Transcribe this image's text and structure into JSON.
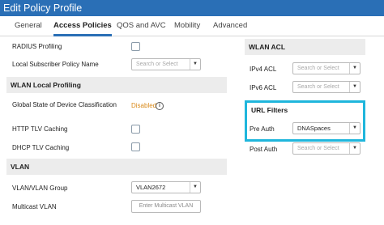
{
  "window": {
    "title": "Edit Policy Profile"
  },
  "tabs": [
    {
      "label": "General"
    },
    {
      "label": "Access Policies"
    },
    {
      "label": "QOS and AVC"
    },
    {
      "label": "Mobility"
    },
    {
      "label": "Advanced"
    }
  ],
  "left": {
    "radius_profiling": {
      "label": "RADIUS Profiling"
    },
    "local_subscriber": {
      "label": "Local Subscriber Policy Name",
      "placeholder": "Search or Select"
    },
    "wlan_local_profiling": {
      "title": "WLAN Local Profiling"
    },
    "global_state": {
      "label": "Global State of Device Classification",
      "value": "Disabled"
    },
    "http_tlv": {
      "label": "HTTP TLV Caching"
    },
    "dhcp_tlv": {
      "label": "DHCP TLV Caching"
    },
    "vlan": {
      "title": "VLAN"
    },
    "vlan_group": {
      "label": "VLAN/VLAN Group",
      "value": "VLAN2672"
    },
    "multicast_vlan": {
      "label": "Multicast VLAN",
      "placeholder": "Enter Multicast VLAN"
    }
  },
  "right": {
    "wlan_acl": {
      "title": "WLAN ACL"
    },
    "ipv4_acl": {
      "label": "IPv4 ACL",
      "placeholder": "Search or Select"
    },
    "ipv6_acl": {
      "label": "IPv6 ACL",
      "placeholder": "Search or Select"
    },
    "url_filters": {
      "title": "URL Filters"
    },
    "pre_auth": {
      "label": "Pre Auth",
      "value": "DNASpaces"
    },
    "post_auth": {
      "label": "Post Auth",
      "placeholder": "Search or Select"
    }
  },
  "colors": {
    "titlebar": "#2a6fb6",
    "highlight": "#1fb6dc",
    "disabled": "#d98a1a"
  },
  "icons": {
    "dropdown": "chevron-down-icon",
    "info": "info-icon"
  }
}
